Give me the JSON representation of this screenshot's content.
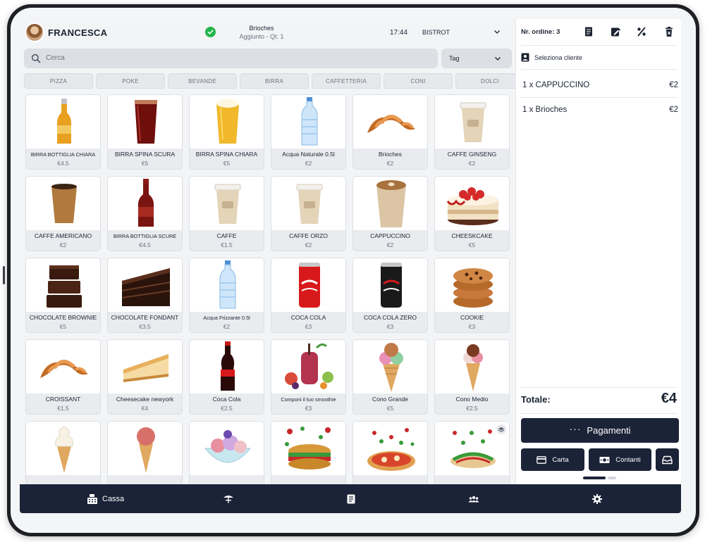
{
  "user": {
    "name": "FRANCESCA"
  },
  "notification": {
    "title": "Brioches",
    "subtitle": "Aggiunto - Qt: 1"
  },
  "status": {
    "time": "17:44",
    "location": "BISTROT"
  },
  "search": {
    "placeholder": "Cerca"
  },
  "tag_filter": {
    "label": "Tag"
  },
  "categories": [
    "PIZZA",
    "POKE",
    "BEVANDE",
    "BIRRA",
    "CAFFETTERIA",
    "CONI",
    "DOLCI"
  ],
  "products": [
    {
      "name": "BIRRA BOTTIGLIA CHIARA",
      "price": "€4.5",
      "icon": "beer-bottle-light"
    },
    {
      "name": "BIRRA SPINA SCURA",
      "price": "€5",
      "icon": "dark-beer-glass"
    },
    {
      "name": "BIRRA SPINA CHIARA",
      "price": "€5",
      "icon": "light-beer-glass"
    },
    {
      "name": "Acqua Naturale 0.5l",
      "price": "€2",
      "icon": "water-bottle"
    },
    {
      "name": "Brioches",
      "price": "€2",
      "icon": "croissant"
    },
    {
      "name": "CAFFE GINSENG",
      "price": "€2",
      "icon": "coffee-cup"
    },
    {
      "name": "CAFFE AMERICANO",
      "price": "€2",
      "icon": "coffee-cup-dark"
    },
    {
      "name": "BIRRA BOTTIGLIA SCURE",
      "price": "€4.5",
      "icon": "beer-bottle-dark"
    },
    {
      "name": "CAFFE",
      "price": "€1.5",
      "icon": "coffee-cup"
    },
    {
      "name": "CAFFE ORZO",
      "price": "€2",
      "icon": "coffee-cup"
    },
    {
      "name": "CAPPUCCINO",
      "price": "€2",
      "icon": "cappuccino"
    },
    {
      "name": "CHEESKCAKE",
      "price": "€5",
      "icon": "cake"
    },
    {
      "name": "CHOCOLATE BROWNIE",
      "price": "€5",
      "icon": "brownie"
    },
    {
      "name": "CHOCOLATE FONDANT",
      "price": "€3.5",
      "icon": "chocolate-cake"
    },
    {
      "name": "Acqua Frizzante 0.5l",
      "price": "€2",
      "icon": "water-bottle"
    },
    {
      "name": "COCA COLA",
      "price": "€3",
      "icon": "soda-can-red"
    },
    {
      "name": "COCA COLA ZERO",
      "price": "€3",
      "icon": "soda-can-black"
    },
    {
      "name": "COOKIE",
      "price": "€3",
      "icon": "cookies"
    },
    {
      "name": "CROISSANT",
      "price": "€1.5",
      "icon": "croissant"
    },
    {
      "name": "Cheesecake newyork",
      "price": "€4",
      "icon": "cheesecake-slice"
    },
    {
      "name": "Coca Cola",
      "price": "€2.5",
      "icon": "soda-bottle"
    },
    {
      "name": "Componi il tuo smoothie",
      "price": "€3",
      "icon": "smoothie"
    },
    {
      "name": "Cono Grande",
      "price": "€5",
      "icon": "ice-cream-cone-large"
    },
    {
      "name": "Cono Medio",
      "price": "€2.5",
      "icon": "ice-cream-cone"
    },
    {
      "name": "",
      "price": "",
      "icon": "soft-serve-cone"
    },
    {
      "name": "",
      "price": "",
      "icon": "ice-cream-cone-pink"
    },
    {
      "name": "",
      "price": "",
      "icon": "gelato-bowl"
    },
    {
      "name": "",
      "price": "",
      "icon": "sandwich"
    },
    {
      "name": "",
      "price": "",
      "icon": "pizza"
    },
    {
      "name": "",
      "price": "",
      "icon": "piadina"
    }
  ],
  "order": {
    "number_label": "Nr. ordine: 3",
    "customer_label": "Seleziona cliente",
    "items": [
      {
        "label": "1 x CAPPUCCINO",
        "price": "€2"
      },
      {
        "label": "1 x Brioches",
        "price": "€2"
      }
    ],
    "total_label": "Totale:",
    "total_value": "€4",
    "pay_label": "Pagamenti",
    "card_label": "Carta",
    "cash_label": "Contanti"
  },
  "nav": {
    "cassa_label": "Cassa"
  },
  "colors": {
    "navy": "#1b2338",
    "success": "#22b54a",
    "panel": "#f3f4f6"
  }
}
